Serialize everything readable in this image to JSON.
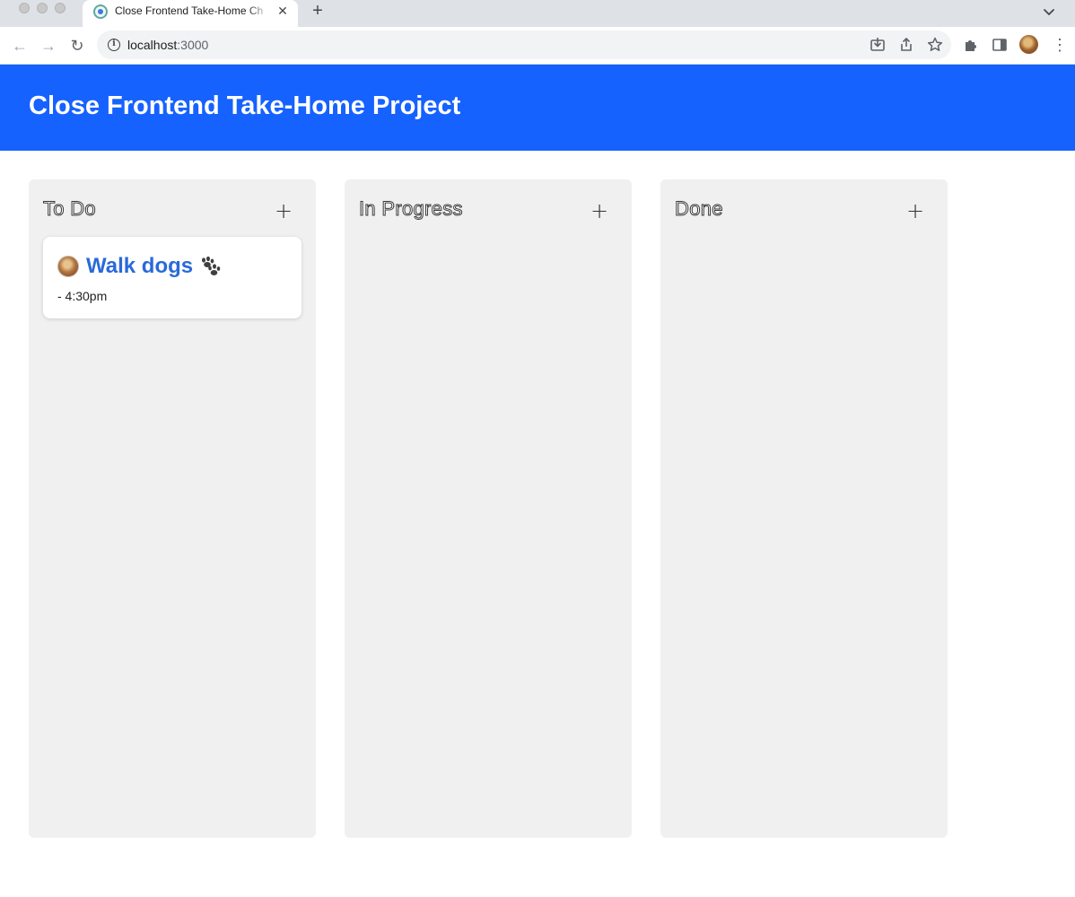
{
  "browser": {
    "tab_title": "Close Frontend Take-Home Ch",
    "tab_close": "✕",
    "new_tab": "+",
    "url_host": "localhost",
    "url_port": ":3000",
    "back_glyph": "←",
    "forward_glyph": "→",
    "reload_glyph": "↻",
    "menu_glyph": "⋮",
    "info_glyph": "i"
  },
  "app": {
    "title": "Close Frontend Take-Home Project",
    "accent_color": "#1662ff",
    "add_glyph": "+"
  },
  "columns": [
    {
      "title": "To Do",
      "cards": [
        {
          "title": "Walk dogs",
          "emoji": "paws-icon",
          "time": "- 4:30pm"
        }
      ]
    },
    {
      "title": "In Progress",
      "cards": []
    },
    {
      "title": "Done",
      "cards": []
    }
  ]
}
